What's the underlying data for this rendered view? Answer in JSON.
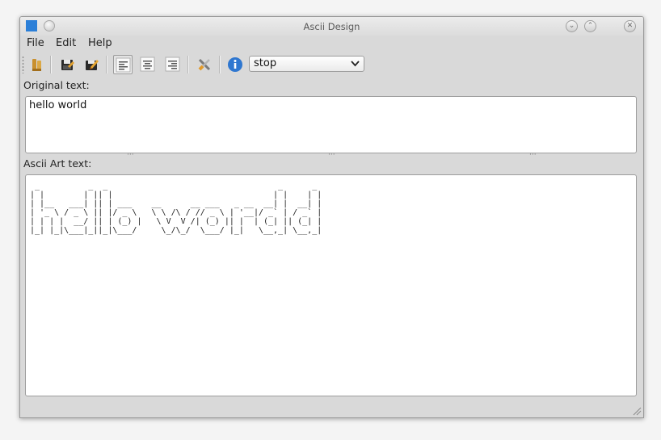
{
  "window": {
    "title": "Ascii Design"
  },
  "menu": {
    "file": "File",
    "edit": "Edit",
    "help": "Help"
  },
  "toolbar": {
    "icons": [
      "open-file-icon",
      "save-icon",
      "save-as-icon",
      "align-left-icon",
      "align-center-icon",
      "align-right-icon",
      "tools-icon",
      "info-icon"
    ],
    "align_checked": "left",
    "font_combo_value": "stop"
  },
  "original": {
    "label": "Original text:",
    "value": "hello world"
  },
  "ascii": {
    "label": "Ascii Art text:",
    "art": " _          _  _                                   _      _\n| |        | || |                                 | |    | |\n| |__   ___| || | ___    __      __ ___   _ __  __| |  __| |\n| '_ \\ / _ \\ || |/ _ \\   \\ \\ /\\ / // _ \\ | '__|/ _` | / _` |\n| | | |  __/ || | (_) |   \\ V  V /| (_) || |  | (_| || (_| |\n|_| |_|\\___|_||_|\\___/     \\_/\\_/  \\___/ |_|   \\__,_| \\__,_|"
  },
  "colors": {
    "window_bg": "#d9d9d9",
    "info_blue": "#2f77d0"
  }
}
